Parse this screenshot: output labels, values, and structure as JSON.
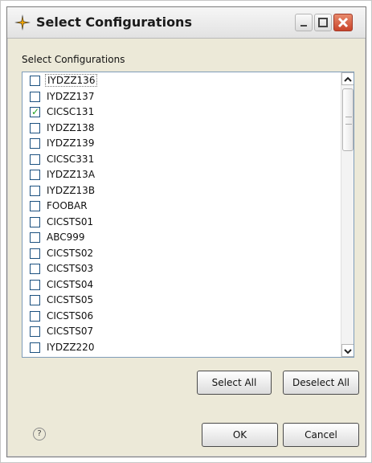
{
  "window": {
    "title": "Select Configurations"
  },
  "section_label": "Select Configurations",
  "items": [
    {
      "label": "IYDZZ136",
      "checked": false
    },
    {
      "label": "IYDZZ137",
      "checked": false
    },
    {
      "label": "CICSC131",
      "checked": true
    },
    {
      "label": "IYDZZ138",
      "checked": false
    },
    {
      "label": "IYDZZ139",
      "checked": false
    },
    {
      "label": "CICSC331",
      "checked": false
    },
    {
      "label": "IYDZZ13A",
      "checked": false
    },
    {
      "label": "IYDZZ13B",
      "checked": false
    },
    {
      "label": "FOOBAR",
      "checked": false
    },
    {
      "label": "CICSTS01",
      "checked": false
    },
    {
      "label": "ABC999",
      "checked": false
    },
    {
      "label": "CICSTS02",
      "checked": false
    },
    {
      "label": "CICSTS03",
      "checked": false
    },
    {
      "label": "CICSTS04",
      "checked": false
    },
    {
      "label": "CICSTS05",
      "checked": false
    },
    {
      "label": "CICSTS06",
      "checked": false
    },
    {
      "label": "CICSTS07",
      "checked": false
    },
    {
      "label": "IYDZZ220",
      "checked": false
    }
  ],
  "buttons": {
    "select_all": "Select All",
    "deselect_all": "Deselect All",
    "ok": "OK",
    "cancel": "Cancel"
  },
  "help": "?",
  "check_glyph": "✓",
  "colors": {
    "check": "#21a121",
    "close": "#c9442a"
  }
}
